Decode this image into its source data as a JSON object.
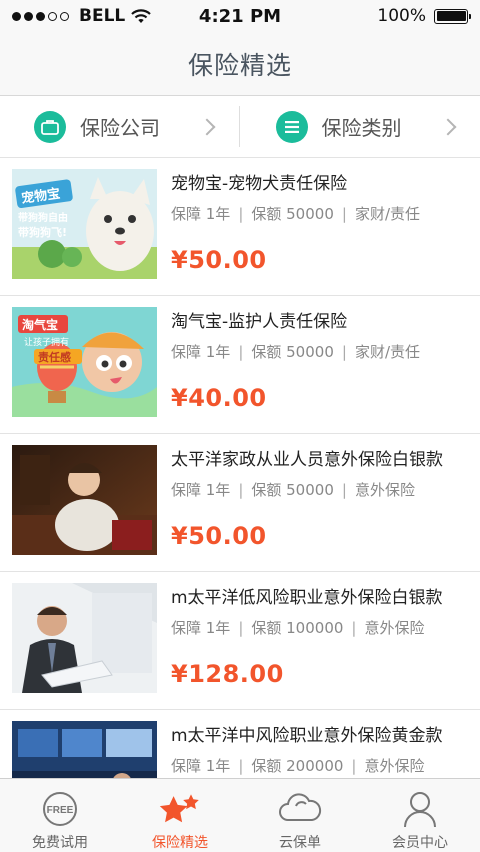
{
  "status_bar": {
    "carrier": "BELL",
    "time": "4:21 PM",
    "battery": "100%",
    "signal_icon": "signal-dots-icon",
    "wifi_icon": "wifi-icon",
    "battery_icon": "battery-icon"
  },
  "nav": {
    "title": "保险精选"
  },
  "filters": [
    {
      "label": "保险公司",
      "icon": "briefcase-icon"
    },
    {
      "label": "保险类别",
      "icon": "list-icon"
    }
  ],
  "products": [
    {
      "title": "宠物宝-宠物犬责任保险",
      "term": "保障 1年",
      "coverage": "保额 50000",
      "category": "家财/责任",
      "price": "¥50.00",
      "image_text": [
        "宠物宝",
        "带狗狗自由",
        "带狗狗飞!"
      ]
    },
    {
      "title": "淘气宝-监护人责任保险",
      "term": "保障 1年",
      "coverage": "保额 50000",
      "category": "家财/责任",
      "price": "¥40.00",
      "image_text": [
        "淘气宝",
        "让孩子拥有",
        "责任感"
      ]
    },
    {
      "title": "太平洋家政从业人员意外保险白银款",
      "term": "保障 1年",
      "coverage": "保额 50000",
      "category": "意外保险",
      "price": "¥50.00"
    },
    {
      "title": "m太平洋低风险职业意外保险白银款",
      "term": "保障 1年",
      "coverage": "保额 100000",
      "category": "意外保险",
      "price": "¥128.00"
    },
    {
      "title": "m太平洋中风险职业意外保险黄金款",
      "term": "保障 1年",
      "coverage": "保额 200000",
      "category": "意外保险",
      "price": ""
    }
  ],
  "tabs": [
    {
      "label": "免费试用",
      "icon": "free-badge-icon",
      "icon_text": "FREE",
      "active": false
    },
    {
      "label": "保险精选",
      "icon": "stars-icon",
      "active": true
    },
    {
      "label": "云保单",
      "icon": "cloud-icon",
      "active": false
    },
    {
      "label": "会员中心",
      "icon": "person-icon",
      "active": false
    }
  ],
  "colors": {
    "accent": "#f2552c",
    "teal": "#1bbc9b",
    "nav_text": "#4a5560"
  }
}
